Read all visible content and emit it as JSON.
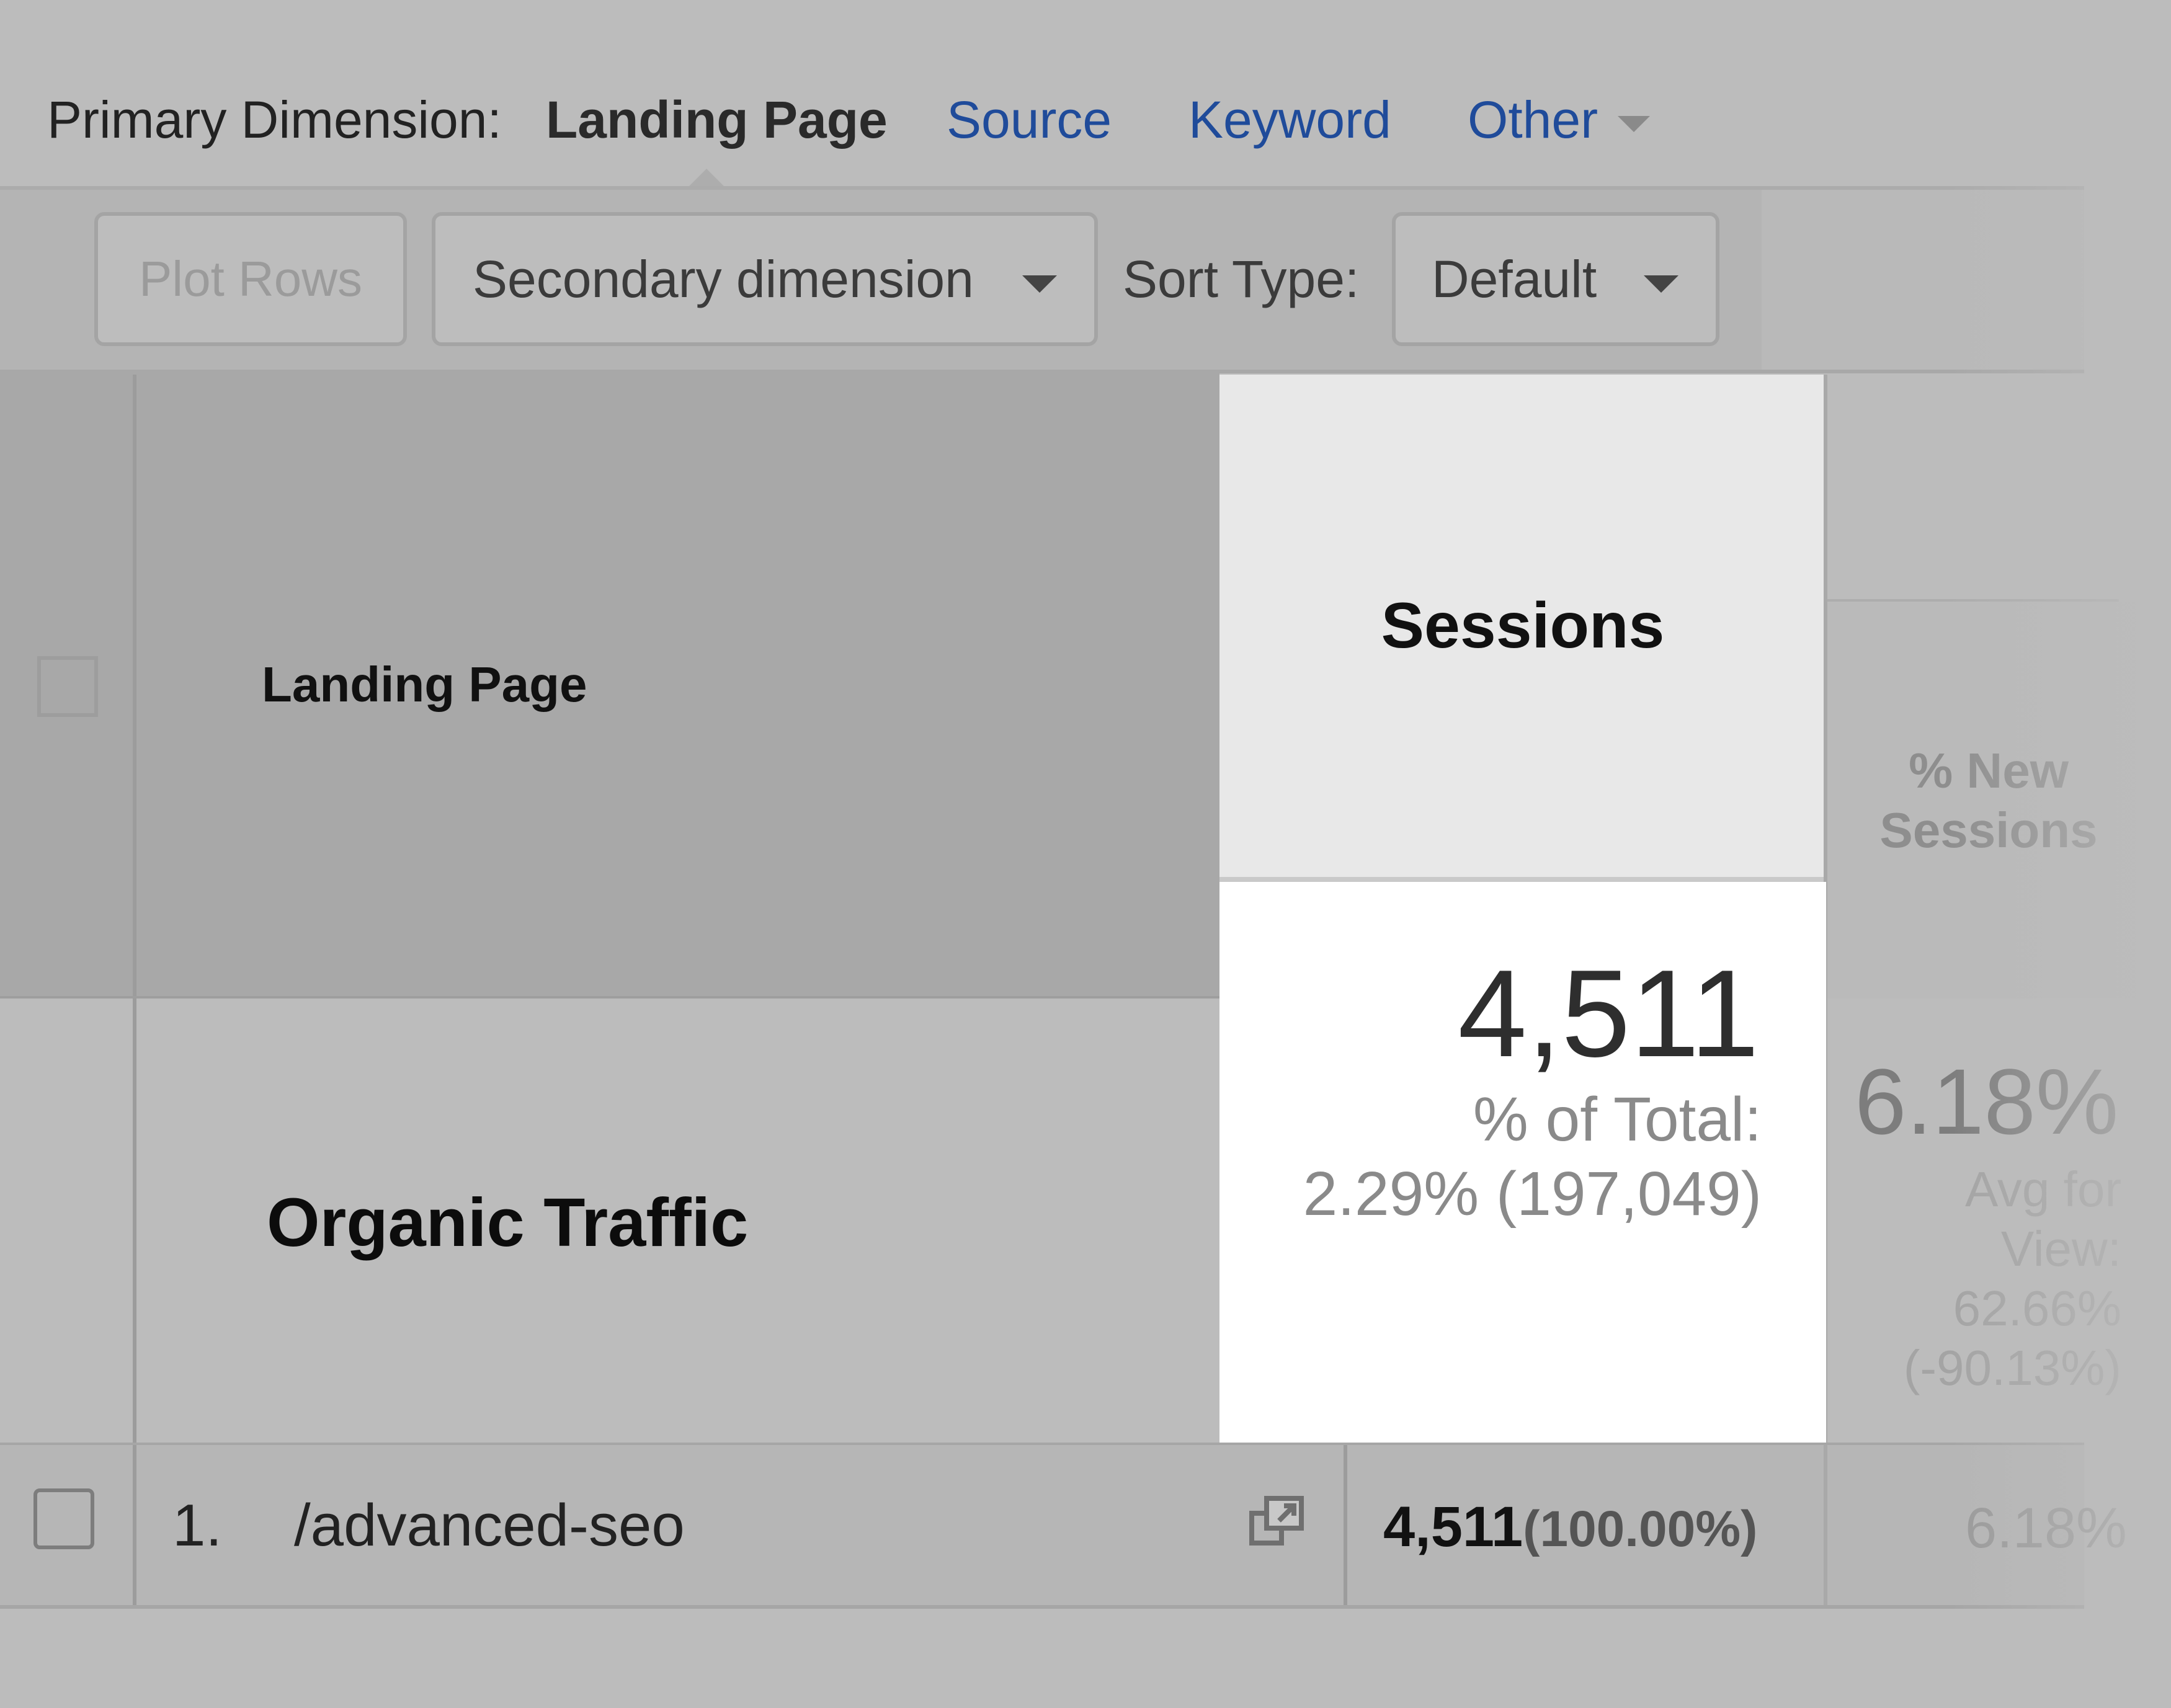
{
  "dimension_bar": {
    "label": "Primary Dimension:",
    "active": "Landing Page",
    "links": [
      "Source",
      "Keyword",
      "Other"
    ]
  },
  "toolbar": {
    "plot_rows": "Plot Rows",
    "secondary_dimension": "Secondary dimension",
    "sort_label": "Sort Type:",
    "sort_value": "Default"
  },
  "table": {
    "header": {
      "landing_page": "Landing Page",
      "sessions": "Sessions",
      "new_sessions": "% New Sessions"
    },
    "summary": {
      "label": "Organic Traffic",
      "sessions_value": "4,511",
      "sessions_pct_label": "% of Total:",
      "sessions_pct_value": "2.29% (197,049)",
      "new_sessions_value": "6.18%",
      "new_sessions_avg_label": "Avg for View:",
      "new_sessions_avg_value": "62.66%",
      "new_sessions_avg_delta": "(-90.13%)"
    },
    "rows": [
      {
        "num": "1.",
        "path": "/advanced-seo",
        "sessions": "4,511",
        "sessions_pct": "(100.00%)",
        "new_sessions": "6.18%"
      }
    ]
  },
  "icons": {
    "row_action": "open-in-new-window-icon",
    "dropdown": "chevron-down-icon"
  },
  "colors": {
    "link": "#1f4b9a",
    "background": "#bcbcbc",
    "highlight": "#ffffff"
  }
}
